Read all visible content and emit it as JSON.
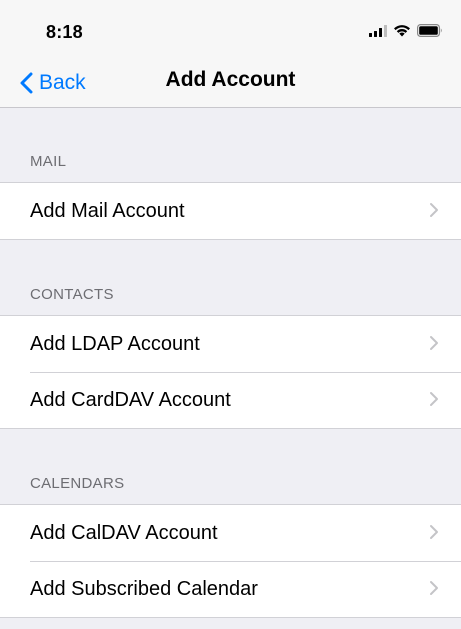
{
  "status_bar": {
    "time": "8:18",
    "icons": [
      "signal-icon",
      "wifi-icon",
      "battery-icon"
    ]
  },
  "nav": {
    "back_label": "Back",
    "title": "Add Account"
  },
  "colors": {
    "accent": "#007aff",
    "background": "#efeff4",
    "header_text": "#6d6d72"
  },
  "sections": [
    {
      "header": "MAIL",
      "items": [
        {
          "label": "Add Mail Account"
        }
      ]
    },
    {
      "header": "CONTACTS",
      "items": [
        {
          "label": "Add LDAP Account"
        },
        {
          "label": "Add CardDAV Account"
        }
      ]
    },
    {
      "header": "CALENDARS",
      "items": [
        {
          "label": "Add CalDAV Account"
        },
        {
          "label": "Add Subscribed Calendar"
        }
      ]
    }
  ]
}
